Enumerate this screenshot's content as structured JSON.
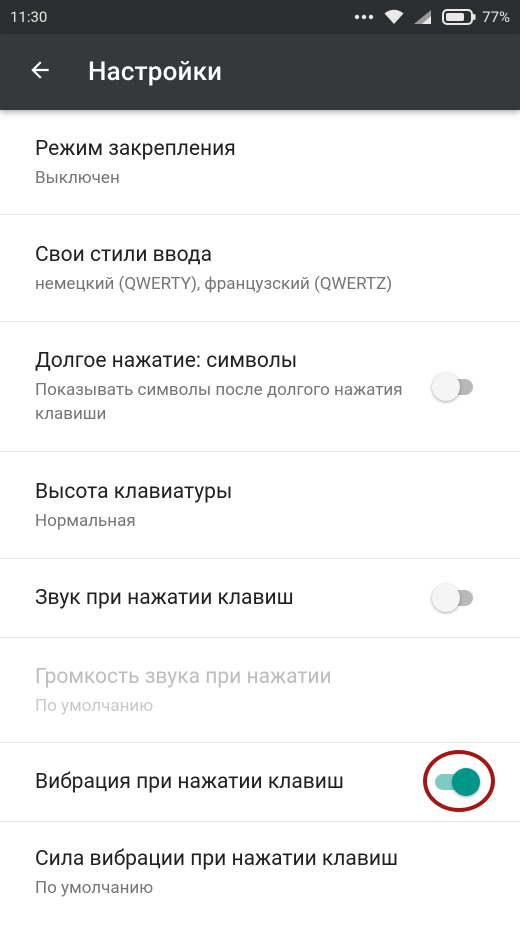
{
  "statusbar": {
    "time": "11:30",
    "battery": "77%"
  },
  "appbar": {
    "title": "Настройки"
  },
  "rows": [
    {
      "title": "Режим закрепления",
      "subtitle": "Выключен"
    },
    {
      "title": "Свои стили ввода",
      "subtitle": "немецкий (QWERTY), французский (QWERTZ)"
    },
    {
      "title": "Долгое нажатие: символы",
      "subtitle": "Показывать символы после долгого нажатия клавиши",
      "switch": false
    },
    {
      "title": "Высота клавиатуры",
      "subtitle": "Нормальная"
    },
    {
      "title": "Звук при нажатии клавиш",
      "switch": false
    },
    {
      "title": "Громкость звука при нажатии",
      "subtitle": "По умолчанию",
      "disabled": true
    },
    {
      "title": "Вибрация при нажатии клавиш",
      "switch": true,
      "highlighted": true
    },
    {
      "title": "Сила вибрации при нажатии клавиш",
      "subtitle": "По умолчанию"
    }
  ],
  "colors": {
    "accent": "#009688",
    "highlight": "#a31616",
    "appbar": "#35393b",
    "statusbar": "#2b2f30"
  }
}
